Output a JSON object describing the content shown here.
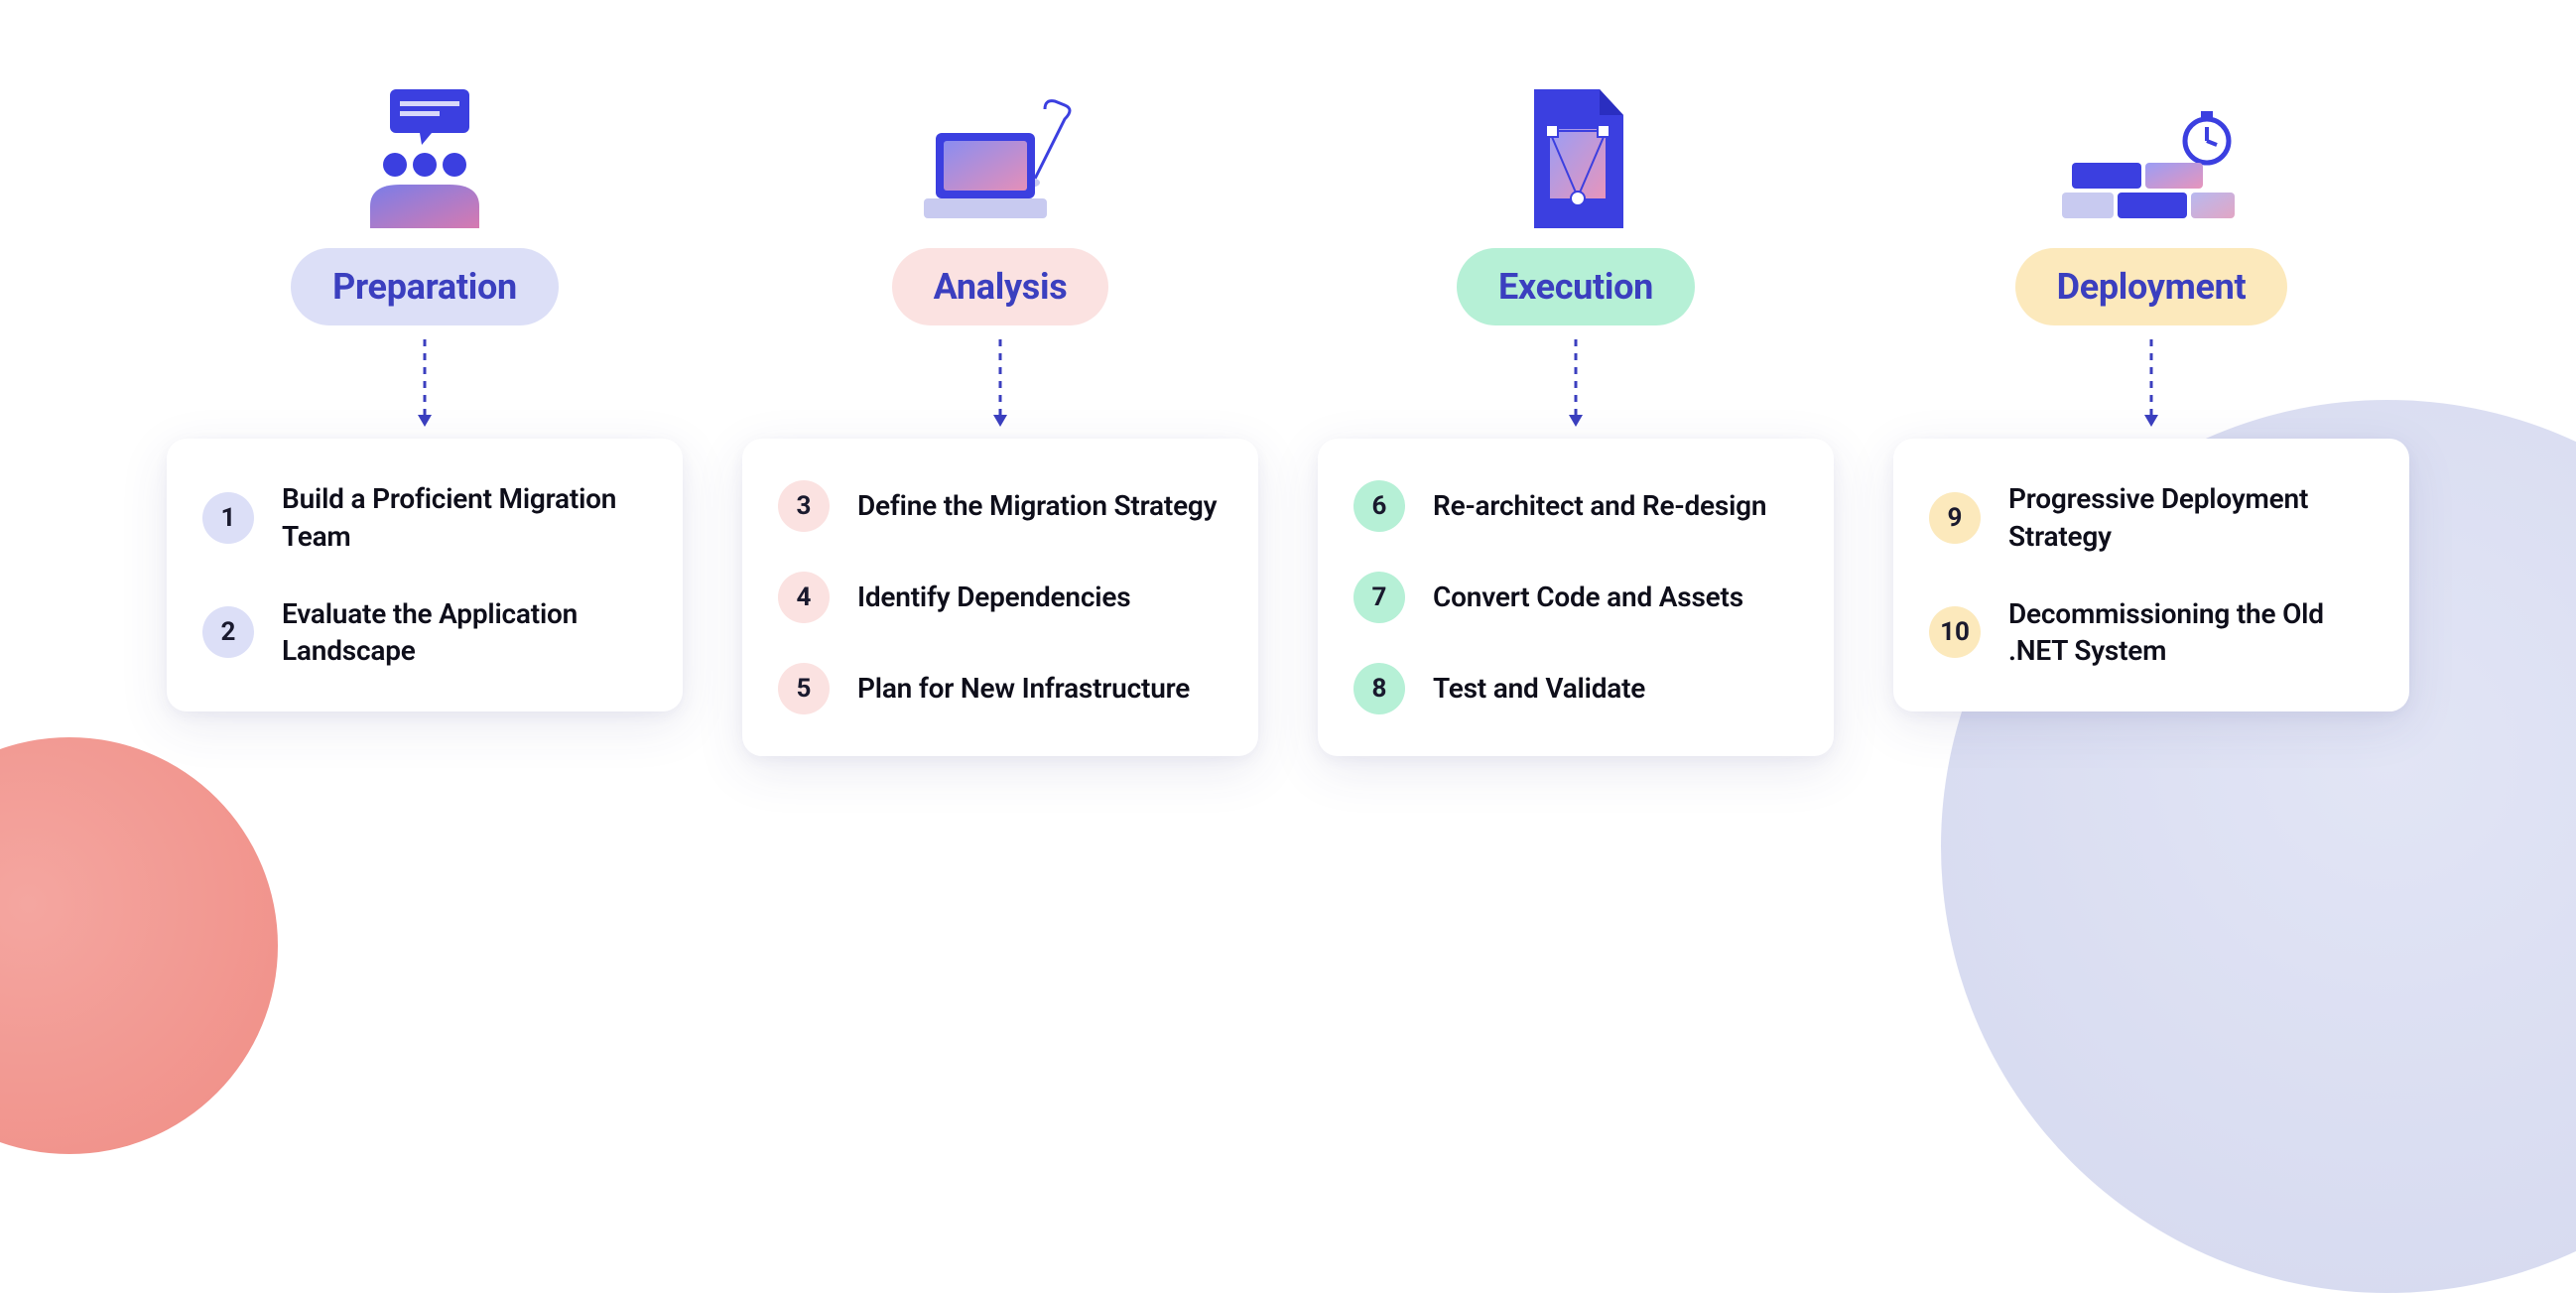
{
  "phases": [
    {
      "key": "preparation",
      "label": "Preparation",
      "pillClass": "pill-preparation",
      "badgeClass": "badge-preparation",
      "steps": [
        {
          "n": "1",
          "text": "Build a Proficient Migration Team"
        },
        {
          "n": "2",
          "text": "Evaluate the Application Landscape"
        }
      ]
    },
    {
      "key": "analysis",
      "label": "Analysis",
      "pillClass": "pill-analysis",
      "badgeClass": "badge-analysis",
      "steps": [
        {
          "n": "3",
          "text": "Define the Migration Strategy"
        },
        {
          "n": "4",
          "text": "Identify Dependencies"
        },
        {
          "n": "5",
          "text": "Plan for New Infrastructure"
        }
      ]
    },
    {
      "key": "execution",
      "label": "Execution",
      "pillClass": "pill-execution",
      "badgeClass": "badge-execution",
      "steps": [
        {
          "n": "6",
          "text": "Re-architect and Re-design"
        },
        {
          "n": "7",
          "text": "Convert Code and Assets"
        },
        {
          "n": "8",
          "text": "Test and Validate"
        }
      ]
    },
    {
      "key": "deployment",
      "label": "Deployment",
      "pillClass": "pill-deployment",
      "badgeClass": "badge-deployment",
      "steps": [
        {
          "n": "9",
          "text": "Progressive Deployment Strategy"
        },
        {
          "n": "10",
          "text": "Decommissioning the Old .NET System"
        }
      ]
    }
  ],
  "colors": {
    "arrow": "#3b3fbf"
  }
}
